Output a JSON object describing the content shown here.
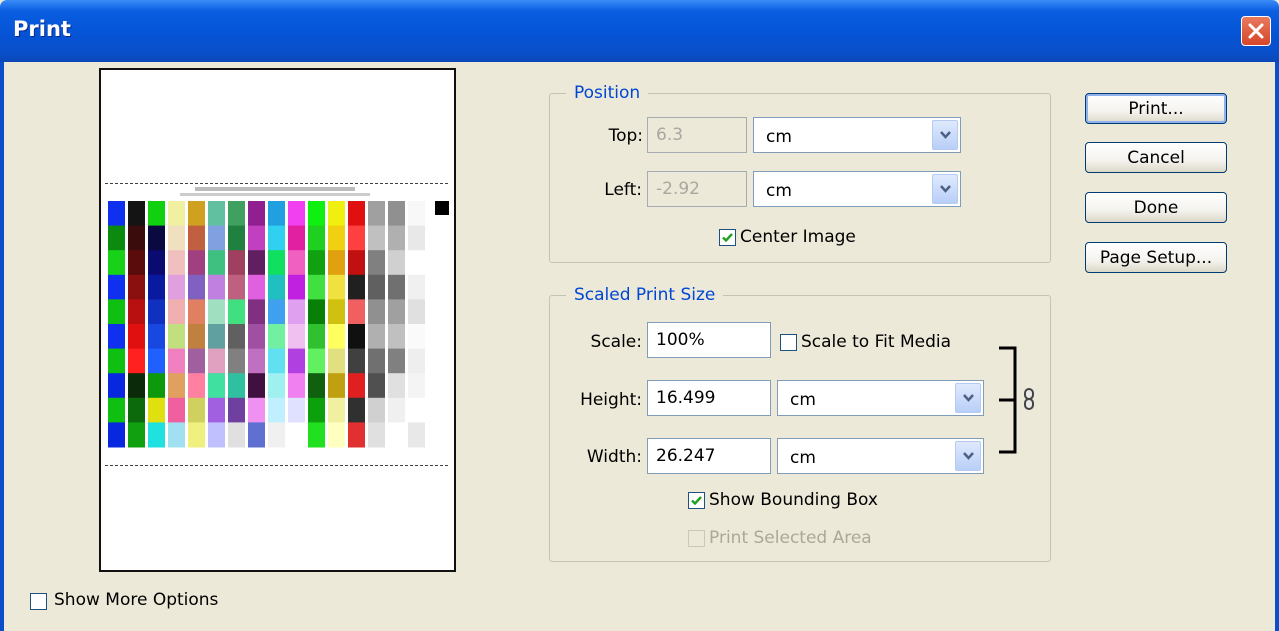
{
  "window": {
    "title": "Print"
  },
  "position": {
    "group_title": "Position",
    "top": {
      "label": "Top:",
      "value": "6.3",
      "unit": "cm"
    },
    "left": {
      "label": "Left:",
      "value": "-2.92",
      "unit": "cm"
    },
    "center_image": {
      "label": "Center Image",
      "checked": true
    }
  },
  "scaled": {
    "group_title": "Scaled Print Size",
    "scale": {
      "label": "Scale:",
      "value": "100%"
    },
    "scale_to_fit": {
      "label": "Scale to Fit Media",
      "checked": false
    },
    "height": {
      "label": "Height:",
      "value": "16.499",
      "unit": "cm"
    },
    "width": {
      "label": "Width:",
      "value": "26.247",
      "unit": "cm"
    },
    "show_bounding_box": {
      "label": "Show Bounding Box",
      "checked": true
    },
    "print_selected_area": {
      "label": "Print Selected Area",
      "checked": false,
      "disabled": true
    }
  },
  "buttons": {
    "print": "Print...",
    "cancel": "Cancel",
    "done": "Done",
    "page_setup": "Page Setup..."
  },
  "show_more_options": {
    "label": "Show More Options",
    "checked": false
  },
  "colors": {
    "title_bar": "#0553d6",
    "group_title": "#0046d5",
    "dialog_bg": "#ece9d8"
  },
  "icons": {
    "close": "close-icon",
    "link": "link-icon",
    "dropdown": "chevron-down-icon",
    "check": "check-icon"
  }
}
